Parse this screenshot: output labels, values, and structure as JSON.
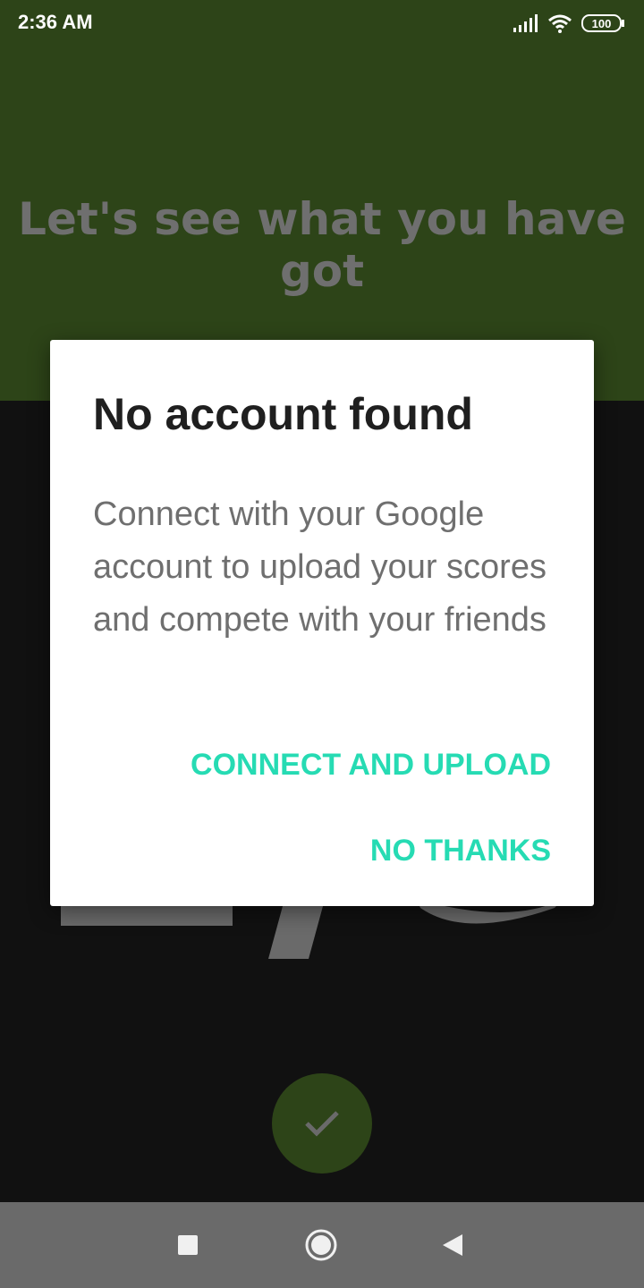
{
  "status_bar": {
    "time": "2:36 AM",
    "battery": "100",
    "icons": [
      "signal-icon",
      "wifi-icon",
      "battery-icon"
    ]
  },
  "screen": {
    "headline": "Let's see what you have got",
    "fab_icon": "check-icon",
    "colors": {
      "header_bg": "#2d4418",
      "body_bg": "#111111",
      "accent": "#26dbb3",
      "headline_text": "#6f6f6f"
    }
  },
  "dialog": {
    "title": "No account found",
    "message": "Connect with your Google account to upload your scores and compete with your friends",
    "connect_label": "CONNECT AND UPLOAD",
    "decline_label": "NO THANKS"
  },
  "nav_bar": {
    "icons": [
      "recent-apps-icon",
      "home-icon",
      "back-icon"
    ]
  }
}
